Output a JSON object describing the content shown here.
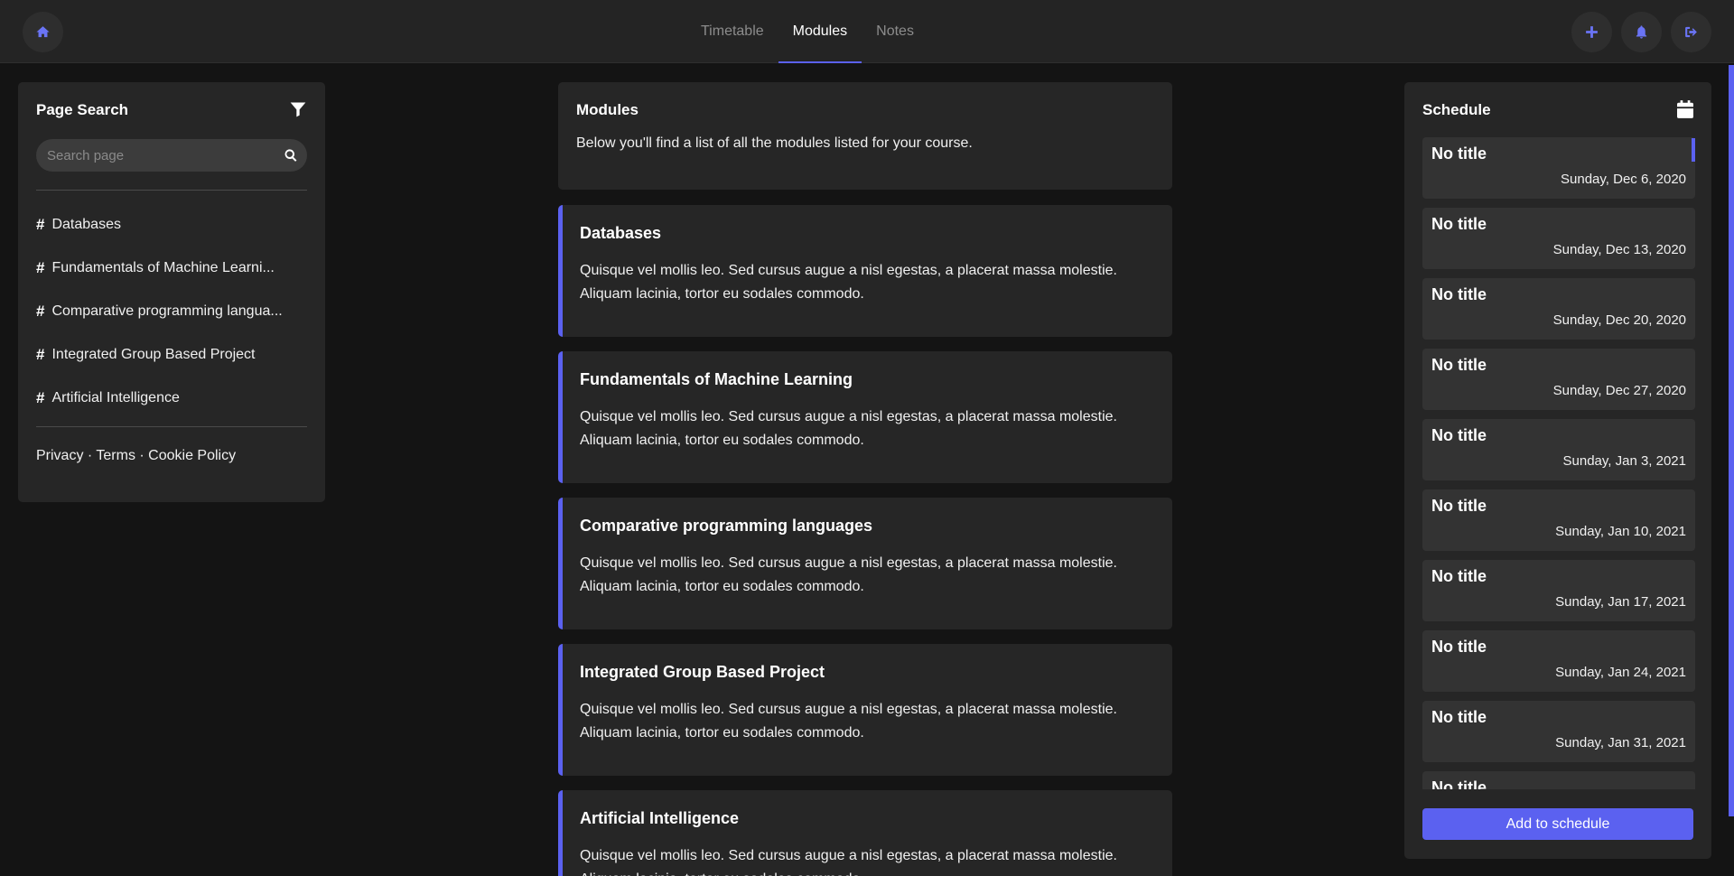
{
  "nav": {
    "tabs": [
      {
        "label": "Timetable",
        "active": false
      },
      {
        "label": "Modules",
        "active": true
      },
      {
        "label": "Notes",
        "active": false
      }
    ],
    "icons": {
      "home": "home-icon",
      "add": "plus-icon",
      "notifications": "bell-icon",
      "logout": "sign-out-icon"
    },
    "accent_color": "#5b61f0"
  },
  "sidebar": {
    "title": "Page Search",
    "search_placeholder": "Search page",
    "items": [
      {
        "label": "Databases"
      },
      {
        "label": "Fundamentals of Machine Learni..."
      },
      {
        "label": "Comparative programming langua..."
      },
      {
        "label": "Integrated Group Based Project"
      },
      {
        "label": "Artificial Intelligence"
      }
    ],
    "footer": {
      "privacy": "Privacy",
      "sep1": " · ",
      "terms": "Terms",
      "sep2": " · ",
      "cookie": "Cookie Policy"
    }
  },
  "main": {
    "intro_title": "Modules",
    "intro_text": "Below you'll find a list of all the modules listed for your course.",
    "modules": [
      {
        "title": "Databases",
        "description": "Quisque vel mollis leo. Sed cursus augue a nisl egestas, a placerat massa molestie. Aliquam lacinia, tortor eu sodales commodo."
      },
      {
        "title": "Fundamentals of Machine Learning",
        "description": "Quisque vel mollis leo. Sed cursus augue a nisl egestas, a placerat massa molestie. Aliquam lacinia, tortor eu sodales commodo."
      },
      {
        "title": "Comparative programming languages",
        "description": "Quisque vel mollis leo. Sed cursus augue a nisl egestas, a placerat massa molestie. Aliquam lacinia, tortor eu sodales commodo."
      },
      {
        "title": "Integrated Group Based Project",
        "description": "Quisque vel mollis leo. Sed cursus augue a nisl egestas, a placerat massa molestie. Aliquam lacinia, tortor eu sodales commodo."
      },
      {
        "title": "Artificial Intelligence",
        "description": "Quisque vel mollis leo. Sed cursus augue a nisl egestas, a placerat massa molestie. Aliquam lacinia, tortor eu sodales commodo."
      }
    ]
  },
  "schedule": {
    "title": "Schedule",
    "items": [
      {
        "title": "No title",
        "date": "Sunday, Dec 6, 2020"
      },
      {
        "title": "No title",
        "date": "Sunday, Dec 13, 2020"
      },
      {
        "title": "No title",
        "date": "Sunday, Dec 20, 2020"
      },
      {
        "title": "No title",
        "date": "Sunday, Dec 27, 2020"
      },
      {
        "title": "No title",
        "date": "Sunday, Jan 3, 2021"
      },
      {
        "title": "No title",
        "date": "Sunday, Jan 10, 2021"
      },
      {
        "title": "No title",
        "date": "Sunday, Jan 17, 2021"
      },
      {
        "title": "No title",
        "date": "Sunday, Jan 24, 2021"
      },
      {
        "title": "No title",
        "date": "Sunday, Jan 31, 2021"
      },
      {
        "title": "No title",
        "date": ""
      }
    ],
    "add_button": "Add to schedule"
  }
}
